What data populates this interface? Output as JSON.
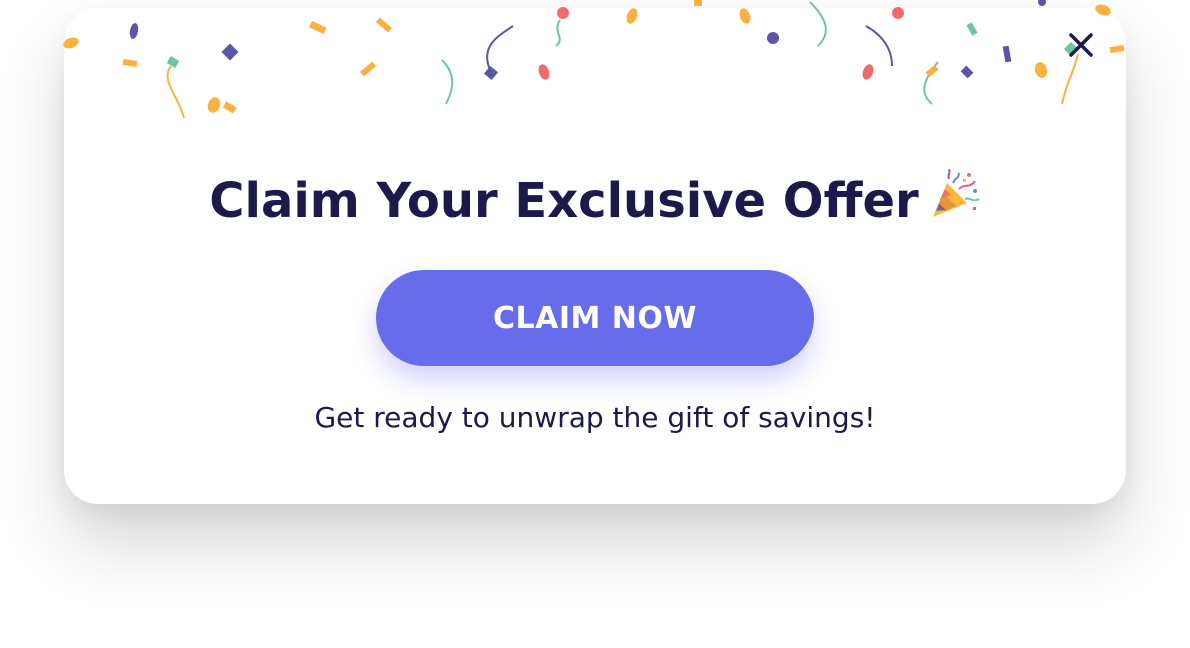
{
  "modal": {
    "title": "Claim Your Exclusive Offer",
    "title_icon": "party-popper-icon",
    "cta_label": "CLAIM NOW",
    "subtitle": "Get ready to unwrap the gift of savings!",
    "close_icon": "close-icon"
  },
  "colors": {
    "primary": "#666cea",
    "text": "#1b1a4b",
    "confetti": [
      "#fbb040",
      "#5b55a8",
      "#f06b6b",
      "#6cc7a0"
    ]
  }
}
